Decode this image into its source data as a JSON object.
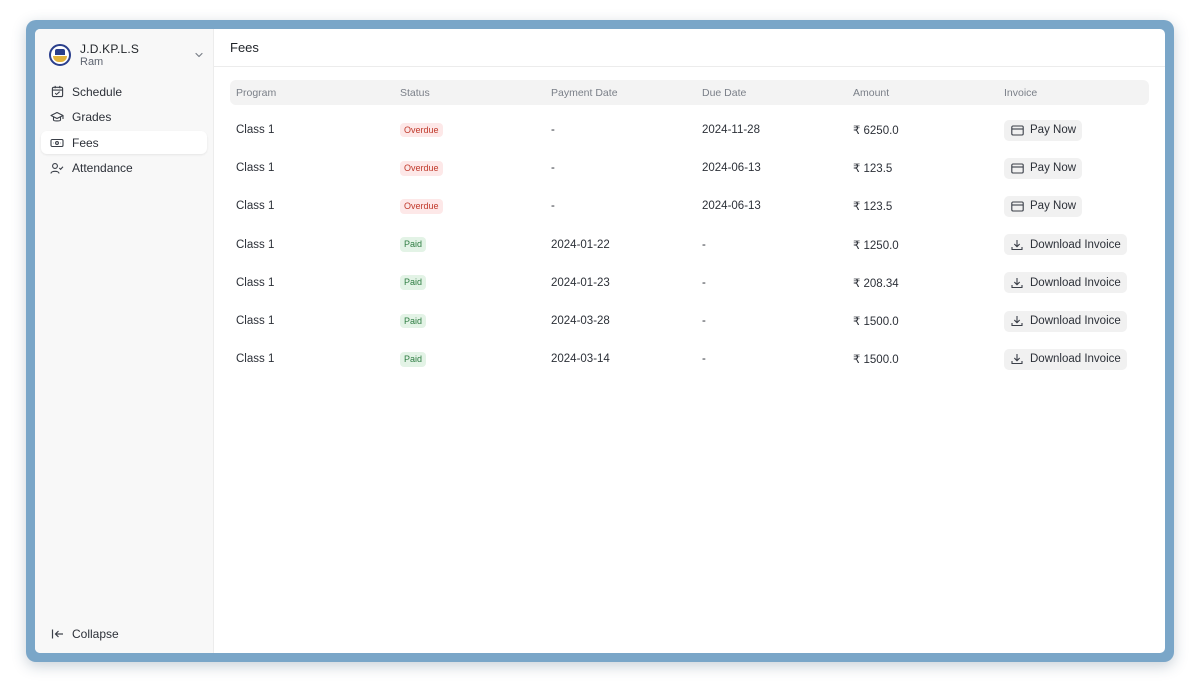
{
  "brand": {
    "name": "J.D.KP.L.S",
    "user": "Ram"
  },
  "sidebar": {
    "items": [
      {
        "label": "Schedule",
        "icon": "calendar-icon"
      },
      {
        "label": "Grades",
        "icon": "graduation-cap-icon"
      },
      {
        "label": "Fees",
        "icon": "banknote-icon",
        "active": true
      },
      {
        "label": "Attendance",
        "icon": "user-check-icon"
      }
    ],
    "collapse_label": "Collapse"
  },
  "header": {
    "title": "Fees"
  },
  "table": {
    "columns": [
      "Program",
      "Status",
      "Payment Date",
      "Due Date",
      "Amount",
      "Invoice"
    ],
    "rows": [
      {
        "program": "Class 1",
        "status": "Overdue",
        "payment_date": "-",
        "due_date": "2024-11-28",
        "amount": "₹ 6250.0",
        "invoice": "Pay Now"
      },
      {
        "program": "Class 1",
        "status": "Overdue",
        "payment_date": "-",
        "due_date": "2024-06-13",
        "amount": "₹ 123.5",
        "invoice": "Pay Now"
      },
      {
        "program": "Class 1",
        "status": "Overdue",
        "payment_date": "-",
        "due_date": "2024-06-13",
        "amount": "₹ 123.5",
        "invoice": "Pay Now"
      },
      {
        "program": "Class 1",
        "status": "Paid",
        "payment_date": "2024-01-22",
        "due_date": "-",
        "amount": "₹ 1250.0",
        "invoice": "Download Invoice"
      },
      {
        "program": "Class 1",
        "status": "Paid",
        "payment_date": "2024-01-23",
        "due_date": "-",
        "amount": "₹ 208.34",
        "invoice": "Download Invoice"
      },
      {
        "program": "Class 1",
        "status": "Paid",
        "payment_date": "2024-03-28",
        "due_date": "-",
        "amount": "₹ 1500.0",
        "invoice": "Download Invoice"
      },
      {
        "program": "Class 1",
        "status": "Paid",
        "payment_date": "2024-03-14",
        "due_date": "-",
        "amount": "₹ 1500.0",
        "invoice": "Download Invoice"
      }
    ]
  },
  "colors": {
    "frame": "#7aa6c8",
    "overdue_bg": "#fde8e8",
    "overdue_text": "#c0392b",
    "paid_bg": "#e3f3e6",
    "paid_text": "#2f7d43"
  }
}
